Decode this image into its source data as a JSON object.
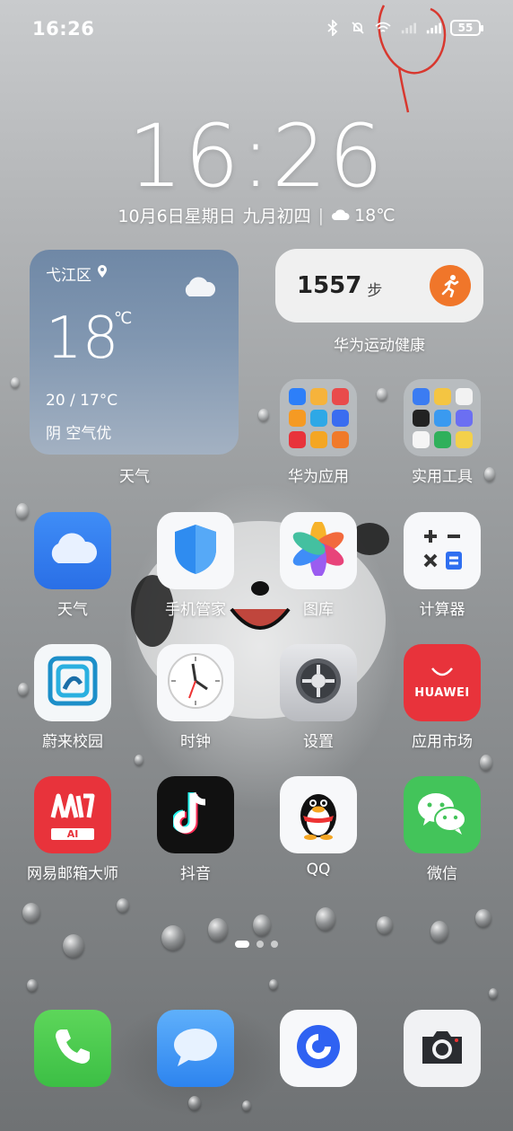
{
  "status_bar": {
    "time": "16:26",
    "battery": "55"
  },
  "lock_clock": {
    "time": "16:26"
  },
  "date_line": {
    "date": "10月6日星期日",
    "lunar": "九月初四",
    "separator": "|",
    "temp": "18℃"
  },
  "weather_widget": {
    "location": "弋江区",
    "temperature": "18",
    "unit": "℃",
    "range": "20 / 17°C",
    "condition": "阴 空气优",
    "label": "天气"
  },
  "steps_widget": {
    "count": "1557",
    "unit": "步",
    "label": "华为运动健康"
  },
  "folders": [
    {
      "label": "华为应用"
    },
    {
      "label": "实用工具"
    }
  ],
  "apps": [
    {
      "label": "天气"
    },
    {
      "label": "手机管家"
    },
    {
      "label": "图库"
    },
    {
      "label": "计算器"
    },
    {
      "label": "蔚来校园"
    },
    {
      "label": "时钟"
    },
    {
      "label": "设置"
    },
    {
      "label": "应用市场"
    },
    {
      "label": "网易邮箱大师"
    },
    {
      "label": "抖音"
    },
    {
      "label": "QQ"
    },
    {
      "label": "微信"
    }
  ],
  "app_badges": {
    "huawei_text": "HUAWEI",
    "mail_ai": "AI"
  },
  "colors": {
    "weather_widget": "#7a90ab",
    "run_button": "#f0762a",
    "wechat": "#43c45a",
    "appmarket": "#e8333b"
  }
}
